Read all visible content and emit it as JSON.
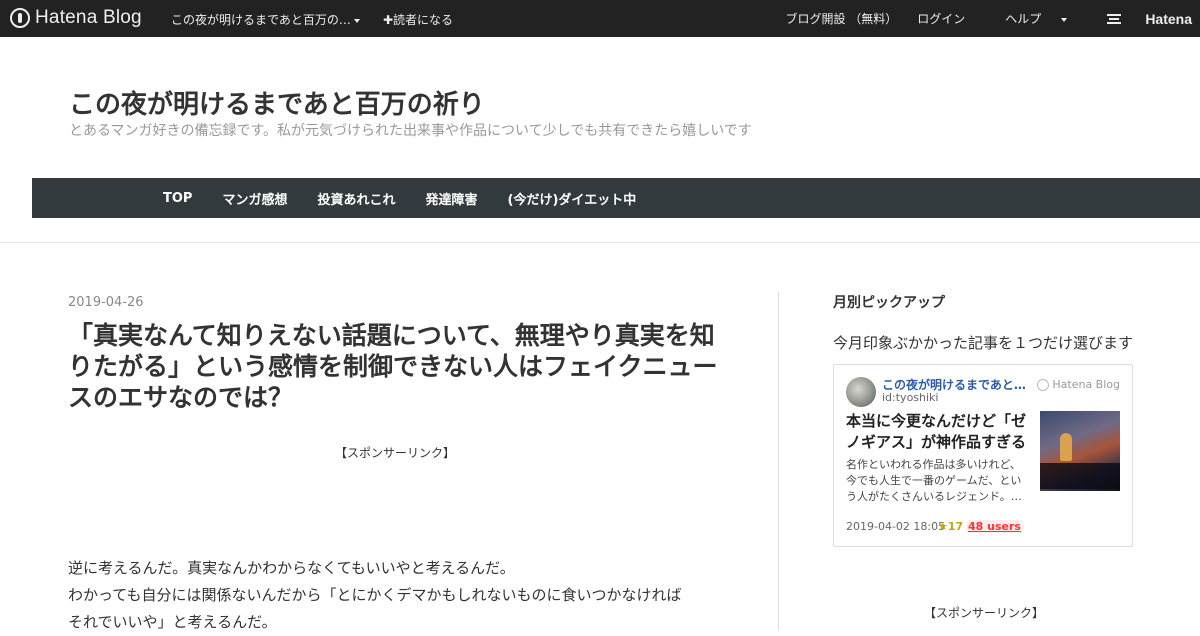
{
  "topbar": {
    "logo_text": "Hatena Blog",
    "blog_name": "この夜が明けるまであと百万の…",
    "follow": "✚読者になる",
    "create_blog": "ブログ開設 （無料）",
    "login": "ログイン",
    "help": "ヘルプ",
    "hatena": "Hatena"
  },
  "header": {
    "title": "この夜が明けるまであと百万の祈り",
    "description": "とあるマンガ好きの備忘録です。私が元気づけられた出来事や作品について少しでも共有できたら嬉しいです"
  },
  "nav": {
    "items": [
      "TOP",
      "マンガ感想",
      "投資あれこれ",
      "発達障害",
      "(今だけ)ダイエット中"
    ]
  },
  "article": {
    "date": "2019-04-26",
    "title": "「真実なんて知りえない話題について、無理やり真実を知りたがる」という感情を制御できない人はフェイクニュースのエサなのでは？",
    "sponsor": "【スポンサーリンク】",
    "paragraph_lines": [
      "逆に考えるんだ。真実なんかわからなくてもいいやと考えるんだ。",
      "わかっても自分には関係ないんだから「とにかくデマかもしれないものに食いつかなければ",
      "それでいいや」と考えるんだ。"
    ]
  },
  "sidebar": {
    "title": "月別ピックアップ",
    "description": "今月印象ぶかかった記事を１つだけ選びます",
    "card": {
      "blog_name": "この夜が明けるまであと百万の祈り",
      "user_id": "id:tyoshiki",
      "service": "Hatena Blog",
      "title": "本当に今更なんだけど「ゼノギアス」が神作品すぎる",
      "excerpt": "名作といわれる作品は多いけれど、今でも人生で一番のゲームだ、という人がたくさんいるレジェンド。…",
      "date": "2019-04-02 18:05",
      "stars": "★17",
      "users": "48 users"
    },
    "sponsor": "【スポンサーリンク】"
  }
}
